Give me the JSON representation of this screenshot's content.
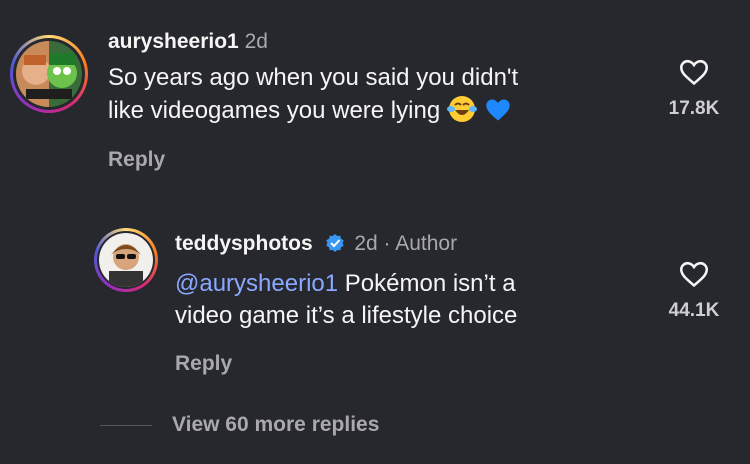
{
  "comments": [
    {
      "username": "aurysheerio1",
      "time": "2d",
      "text_line1": "So years ago when you said you didn't",
      "text_line2": "like videogames you were lying",
      "emojis": [
        "tears-of-joy-emoji",
        "blue-heart-emoji"
      ],
      "reply_label": "Reply",
      "likes": "17.8K"
    },
    {
      "username": "teddysphotos",
      "time": "2d · Author",
      "verified": true,
      "mention": "@aurysheerio1",
      "text_line1_rest": " Pokémon isn’t a",
      "text_line2": "video game it’s a lifestyle choice",
      "reply_label": "Reply",
      "likes": "44.1K"
    }
  ],
  "view_more": "View 60 more replies",
  "colors": {
    "background": "#26282e",
    "mention": "#8aa8ff",
    "verified": "#3897f0",
    "secondary_text": "#a8a8ad"
  }
}
